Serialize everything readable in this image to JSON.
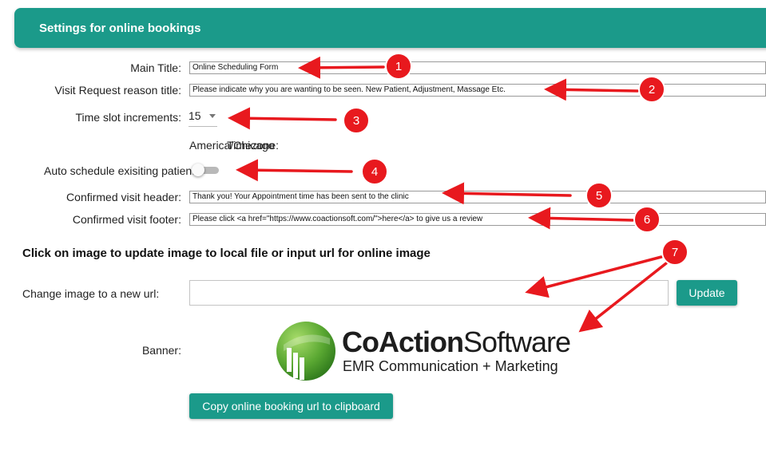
{
  "header": {
    "title": "Settings for online bookings"
  },
  "form": {
    "main_title": {
      "label": "Main Title:",
      "value": "Online Scheduling Form"
    },
    "visit_reason": {
      "label": "Visit Request reason title:",
      "value": "Please indicate why you are wanting to be seen. New Patient, Adjustment, Massage Etc."
    },
    "time_slot": {
      "label": "Time slot increments:",
      "value": "15"
    },
    "timezone": {
      "label": "Timezone:",
      "value": "America/Chicago"
    },
    "auto_schedule": {
      "label": "Auto schedule exisiting patients:",
      "enabled": false
    },
    "confirmed_header": {
      "label": "Confirmed visit header:",
      "value": "Thank you! Your Appointment time has been sent to the clinic"
    },
    "confirmed_footer": {
      "label": "Confirmed visit footer:",
      "value": "Please click <a href=\"https://www.coactionsoft.com/\">here</a> to give us a review"
    }
  },
  "image_section": {
    "title": "Click on image to update image to local file or input url for online image",
    "url_label": "Change image to a new url:",
    "url_value": "",
    "update_button": "Update",
    "banner_label": "Banner:",
    "banner_logo": {
      "brand_bold": "CoAction",
      "brand_light": "Software",
      "tagline": "EMR Communication + Marketing",
      "icon": "bar-chart-sphere-icon"
    }
  },
  "copy_button": "Copy online booking url to clipboard",
  "annotations": [
    "1",
    "2",
    "3",
    "4",
    "5",
    "6",
    "7"
  ],
  "colors": {
    "accent": "#1b9a8a",
    "annotation": "#e8191e",
    "logo_green": "#5aa832"
  }
}
